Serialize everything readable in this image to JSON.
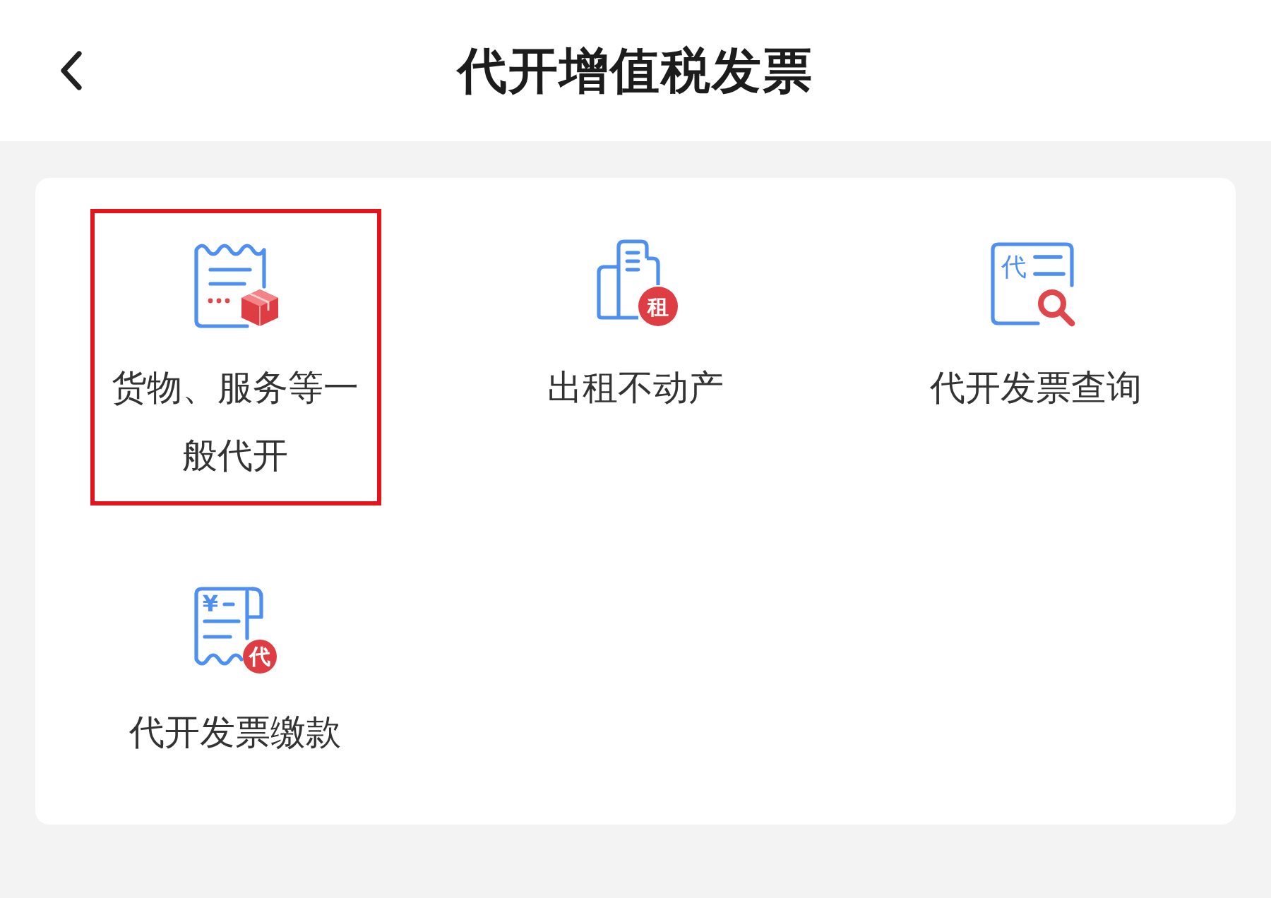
{
  "header": {
    "title": "代开增值税发票"
  },
  "items": [
    {
      "kind": "goods",
      "label": "货物、服务等一般代开",
      "selected": true
    },
    {
      "kind": "rent",
      "label": "出租不动产",
      "badge": "租",
      "selected": false
    },
    {
      "kind": "query",
      "label": "代开发票查询",
      "icon_text": "代",
      "selected": false
    },
    {
      "kind": "payment",
      "label": "代开发票缴款",
      "icon_text": "¥",
      "badge": "代",
      "selected": false
    }
  ]
}
